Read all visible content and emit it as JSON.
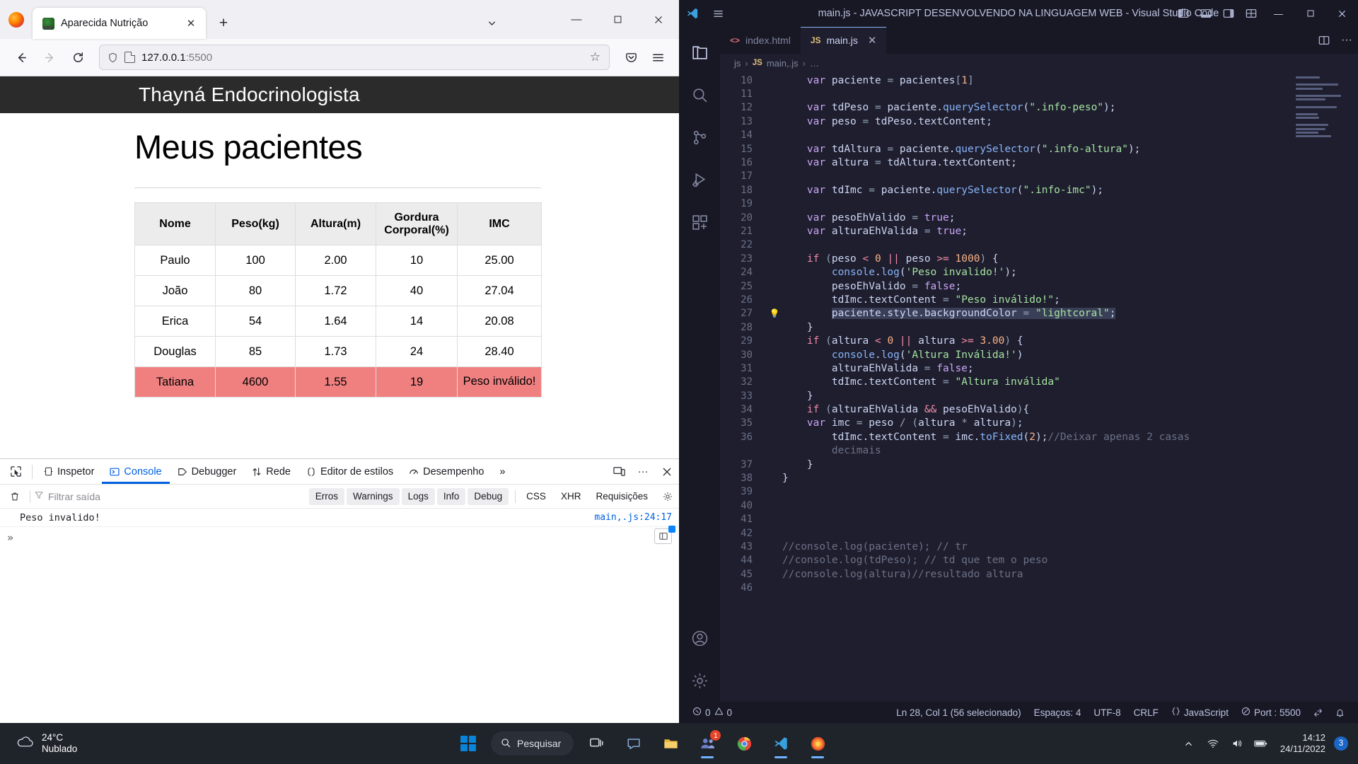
{
  "firefox": {
    "tab": {
      "title": "Aparecida Nutrição",
      "favicon": "avocado-icon",
      "close_label": "✕"
    },
    "newtab_label": "+",
    "list_all_tabs_label": "⌄",
    "window_controls": {
      "minimize": "—",
      "maximize": "▢",
      "close": "✕"
    },
    "nav": {
      "back": "←",
      "forward": "→",
      "reload": "⟳"
    },
    "urlbar": {
      "value": "127.0.0.1",
      "port": ":5500",
      "star": "☆"
    },
    "toolbar_right": {
      "pocket": "◗",
      "menu": "☰"
    },
    "page": {
      "site_header": "Thayná Endocrinologista",
      "title": "Meus pacientes",
      "table": {
        "headers": [
          "Nome",
          "Peso(kg)",
          "Altura(m)",
          "Gordura Corporal(%)",
          "IMC"
        ],
        "rows": [
          {
            "nome": "Paulo",
            "peso": "100",
            "altura": "2.00",
            "gordura": "10",
            "imc": "25.00",
            "invalid": false
          },
          {
            "nome": "João",
            "peso": "80",
            "altura": "1.72",
            "gordura": "40",
            "imc": "27.04",
            "invalid": false
          },
          {
            "nome": "Erica",
            "peso": "54",
            "altura": "1.64",
            "gordura": "14",
            "imc": "20.08",
            "invalid": false
          },
          {
            "nome": "Douglas",
            "peso": "85",
            "altura": "1.73",
            "gordura": "24",
            "imc": "28.40",
            "invalid": false
          },
          {
            "nome": "Tatiana",
            "peso": "4600",
            "altura": "1.55",
            "gordura": "19",
            "imc": "Peso inválido!",
            "invalid": true
          }
        ]
      }
    },
    "devtools": {
      "picker_icon": "element-picker-icon",
      "tabs": [
        {
          "label": "Inspetor",
          "icon": "inspector-icon",
          "active": false
        },
        {
          "label": "Console",
          "icon": "console-icon",
          "active": true
        },
        {
          "label": "Debugger",
          "icon": "debugger-icon",
          "active": false
        },
        {
          "label": "Rede",
          "icon": "network-icon",
          "active": false
        },
        {
          "label": "Editor de estilos",
          "icon": "style-editor-icon",
          "active": false
        },
        {
          "label": "Desempenho",
          "icon": "performance-icon",
          "active": false
        }
      ],
      "more_tabs_label": "»",
      "right_buttons": {
        "responsive": "responsive-design-icon",
        "meatball": "···",
        "close": "✕"
      },
      "filter": {
        "clear_icon": "trash-icon",
        "funnel_icon": "funnel-icon",
        "placeholder": "Filtrar saída",
        "chips": [
          "Erros",
          "Warnings",
          "Logs",
          "Info",
          "Debug",
          "CSS",
          "XHR",
          "Requisições"
        ],
        "settings_icon": "gear-icon"
      },
      "log": {
        "message": "Peso invalido!",
        "source": "main,.js:24:17"
      },
      "prompt_caret": "»",
      "split_console_icon": "split-console-icon"
    }
  },
  "vscode": {
    "title": "main.js - JAVASCRIPT DESENVOLVENDO NA LINGUAGEM WEB - Visual Studio Code",
    "hamburger_icon": "menu-icon",
    "layout_icons": [
      "panel-left-icon",
      "panel-bottom-icon",
      "panel-right-icon",
      "layout-grid-icon"
    ],
    "window_controls": {
      "minimize": "—",
      "maximize": "▢",
      "close": "✕"
    },
    "activity_bar": [
      {
        "name": "explorer-icon"
      },
      {
        "name": "search-icon"
      },
      {
        "name": "source-control-icon"
      },
      {
        "name": "run-debug-icon"
      },
      {
        "name": "extensions-icon"
      },
      {
        "name": "account-icon"
      },
      {
        "name": "settings-gear-icon"
      }
    ],
    "tabs": [
      {
        "label": "index.html",
        "kind": "html",
        "active": false
      },
      {
        "label": "main.js",
        "kind": "js",
        "active": true,
        "close": "✕"
      }
    ],
    "editor_actions": {
      "split": "split-editor-icon",
      "more": "···"
    },
    "breadcrumb": {
      "folder": "js",
      "file": "main,.js",
      "symbol": "…",
      "sep": "›"
    },
    "status": {
      "errors_icon": "error-circle-icon",
      "errors": "0",
      "warnings_icon": "warning-triangle-icon",
      "warnings": "0",
      "cursor": "Ln 28, Col 1 (56 selecionado)",
      "indent": "Espaços: 4",
      "encoding": "UTF-8",
      "eol": "CRLF",
      "language_icon": "braces-icon",
      "language": "JavaScript",
      "port_icon": "broadcast-icon",
      "port": "Port : 5500",
      "remote_icon": "remote-icon",
      "bell_icon": "bell-icon"
    },
    "code": [
      {
        "n": "10",
        "html": "    <span class='c-key'>var</span> <span class='c-var'>paciente</span> <span class='c-punct'>=</span> <span class='c-var'>pacientes</span><span class='c-punct'>[</span><span class='c-num'>1</span><span class='c-punct'>]</span>"
      },
      {
        "n": "11",
        "html": ""
      },
      {
        "n": "12",
        "html": "    <span class='c-key'>var</span> <span class='c-var'>tdPeso</span> <span class='c-punct'>=</span> <span class='c-var'>paciente</span>.<span class='c-fn'>querySelector</span>(<span class='c-str'>\".info-peso\"</span>);"
      },
      {
        "n": "13",
        "html": "    <span class='c-key'>var</span> <span class='c-var'>peso</span> <span class='c-punct'>=</span> <span class='c-var'>tdPeso</span>.<span class='c-var'>textContent</span>;"
      },
      {
        "n": "14",
        "html": ""
      },
      {
        "n": "15",
        "html": "    <span class='c-key'>var</span> <span class='c-var'>tdAltura</span> <span class='c-punct'>=</span> <span class='c-var'>paciente</span>.<span class='c-fn'>querySelector</span>(<span class='c-str'>\".info-altura\"</span>);"
      },
      {
        "n": "16",
        "html": "    <span class='c-key'>var</span> <span class='c-var'>altura</span> <span class='c-punct'>=</span> <span class='c-var'>tdAltura</span>.<span class='c-var'>textContent</span>;"
      },
      {
        "n": "17",
        "html": ""
      },
      {
        "n": "18",
        "html": "    <span class='c-key'>var</span> <span class='c-var'>tdImc</span> <span class='c-punct'>=</span> <span class='c-var'>paciente</span>.<span class='c-fn'>querySelector</span>(<span class='c-str'>\".info-imc\"</span>);"
      },
      {
        "n": "19",
        "html": ""
      },
      {
        "n": "20",
        "html": "    <span class='c-key'>var</span> <span class='c-var'>pesoEhValido</span> <span class='c-punct'>=</span> <span class='c-key'>true</span>;"
      },
      {
        "n": "21",
        "html": "    <span class='c-key'>var</span> <span class='c-var'>alturaEhValida</span> <span class='c-punct'>=</span> <span class='c-key'>true</span>;"
      },
      {
        "n": "22",
        "html": ""
      },
      {
        "n": "23",
        "html": "    <span class='c-op'>if</span> <span class='c-punct'>(</span><span class='c-var'>peso</span> <span class='c-op'>&lt;</span> <span class='c-num'>0</span> <span class='c-op'>||</span> <span class='c-var'>peso</span> <span class='c-op'>&gt;=</span> <span class='c-num'>1000</span><span class='c-punct'>)</span> {"
      },
      {
        "n": "24",
        "html": "        <span class='c-fn'>console</span>.<span class='c-fn'>log</span>(<span class='c-str'>'Peso invalido!'</span>);"
      },
      {
        "n": "25",
        "html": "        <span class='c-var'>pesoEhValido</span> <span class='c-punct'>=</span> <span class='c-key'>false</span>;"
      },
      {
        "n": "26",
        "html": "        <span class='c-var'>tdImc</span>.<span class='c-var'>textContent</span> <span class='c-punct'>=</span> <span class='c-str'>\"Peso inválido!\"</span>;"
      },
      {
        "n": "27",
        "html": "        <span class='sel'><span class='c-var'>paciente</span>.<span class='c-var'>style</span>.<span class='c-var'>backgroundColor</span> <span class='c-punct'>=</span> <span class='c-str'>\"lightcoral\"</span>;</span>",
        "bulb": "💡",
        "selected": true
      },
      {
        "n": "28",
        "html": "    }"
      },
      {
        "n": "29",
        "html": "    <span class='c-op'>if</span> <span class='c-punct'>(</span><span class='c-var'>altura</span> <span class='c-op'>&lt;</span> <span class='c-num'>0</span> <span class='c-op'>||</span> <span class='c-var'>altura</span> <span class='c-op'>&gt;=</span> <span class='c-num'>3.00</span><span class='c-punct'>)</span> {"
      },
      {
        "n": "30",
        "html": "        <span class='c-fn'>console</span>.<span class='c-fn'>log</span>(<span class='c-str'>'Altura Inválida!'</span>)"
      },
      {
        "n": "31",
        "html": "        <span class='c-var'>alturaEhValida</span> <span class='c-punct'>=</span> <span class='c-key'>false</span>;"
      },
      {
        "n": "32",
        "html": "        <span class='c-var'>tdImc</span>.<span class='c-var'>textContent</span> <span class='c-punct'>=</span> <span class='c-str'>\"Altura inválida\"</span>"
      },
      {
        "n": "33",
        "html": "    }"
      },
      {
        "n": "34",
        "html": "    <span class='c-op'>if</span> <span class='c-punct'>(</span><span class='c-var'>alturaEhValida</span> <span class='c-op'>&amp;&amp;</span> <span class='c-var'>pesoEhValido</span><span class='c-punct'>)</span>{"
      },
      {
        "n": "35",
        "html": "    <span class='c-key'>var</span> <span class='c-var'>imc</span> <span class='c-punct'>=</span> <span class='c-var'>peso</span> <span class='c-punct'>/</span> <span class='c-punct'>(</span><span class='c-var'>altura</span> <span class='c-punct'>*</span> <span class='c-var'>altura</span><span class='c-punct'>)</span>;"
      },
      {
        "n": "36",
        "html": "        <span class='c-var'>tdImc</span>.<span class='c-var'>textContent</span> <span class='c-punct'>=</span> <span class='c-var'>imc</span>.<span class='c-fn'>toFixed</span>(<span class='c-num'>2</span>);<span class='c-cmt'>//Deixar apenas 2 casas</span>"
      },
      {
        "n": "",
        "html": "        <span class='c-cmt'>decimais</span>"
      },
      {
        "n": "37",
        "html": "    }"
      },
      {
        "n": "38",
        "html": "}"
      },
      {
        "n": "39",
        "html": ""
      },
      {
        "n": "40",
        "html": ""
      },
      {
        "n": "41",
        "html": ""
      },
      {
        "n": "42",
        "html": ""
      },
      {
        "n": "43",
        "html": "<span class='c-cmt'>//console.log(paciente); // tr</span>"
      },
      {
        "n": "44",
        "html": "<span class='c-cmt'>//console.log(tdPeso); // td que tem o peso</span>"
      },
      {
        "n": "45",
        "html": "<span class='c-cmt'>//console.log(altura)//resultado altura</span>"
      },
      {
        "n": "46",
        "html": ""
      }
    ]
  },
  "taskbar": {
    "weather": {
      "temp": "24°C",
      "condition": "Nublado",
      "icon": "cloud-icon"
    },
    "start_label": "windows-start-icon",
    "search": {
      "placeholder": "Pesquisar",
      "icon": "search-icon"
    },
    "apps": [
      {
        "name": "task-view-icon",
        "badge": ""
      },
      {
        "name": "chat-teams-icon",
        "badge": ""
      },
      {
        "name": "file-explorer-icon",
        "badge": ""
      },
      {
        "name": "teams-icon",
        "badge": "1"
      },
      {
        "name": "chrome-icon",
        "badge": ""
      },
      {
        "name": "vscode-icon",
        "badge": ""
      },
      {
        "name": "firefox-icon",
        "badge": ""
      }
    ],
    "tray": {
      "chevron": "⌃",
      "wifi": "wifi-icon",
      "volume": "volume-icon",
      "battery": "battery-icon"
    },
    "clock": {
      "time": "14:12",
      "date": "24/11/2022"
    },
    "notification_count": "3"
  },
  "colors": {
    "accent_blue": "#0060df",
    "invalid_row": "#f08080",
    "vscode_bg": "#1e1e2e",
    "vscode_chrome": "#181825",
    "taskbar": "#1f232a"
  }
}
